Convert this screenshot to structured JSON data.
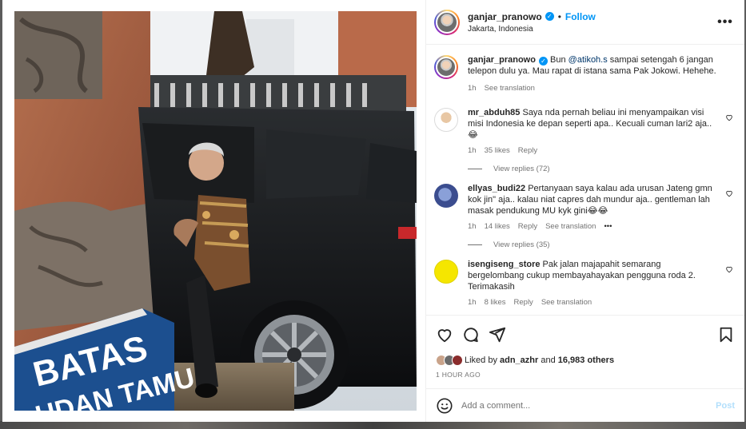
{
  "post": {
    "username": "ganjar_pranowo",
    "follow_label": "Follow",
    "location": "Jakarta, Indonesia",
    "more_label": "•••"
  },
  "photo": {
    "sign_line1": "BATAS",
    "sign_line2": "UDAN TAMU"
  },
  "caption": {
    "username": "ganjar_pranowo",
    "text_before": " Bun ",
    "mention": "@atikoh.s",
    "text_after": " sampai setengah 6 jangan telepon dulu ya. Mau rapat di istana sama Pak Jokowi. Hehehe.",
    "time": "1h",
    "translate": "See translation"
  },
  "comments": [
    {
      "username": "mr_abduh85",
      "text": " Saya nda pernah beliau ini menyampaikan visi misi Indonesia ke depan seperti apa.. Kecuali cuman lari2 aja.. 😂",
      "time": "1h",
      "likes": "35 likes",
      "reply": "Reply",
      "translate": "",
      "view_replies": "View replies (72)"
    },
    {
      "username": "ellyas_budi22",
      "text": " Pertanyaan saya kalau ada urusan Jateng gmn kok jin\" aja.. kalau niat capres dah mundur aja.. gentleman lah masak pendukung MU kyk gini😂😂",
      "time": "1h",
      "likes": "14 likes",
      "reply": "Reply",
      "translate": "See translation",
      "options": "•••",
      "view_replies": "View replies (35)"
    },
    {
      "username": "isengiseng_store",
      "text": " Pak jalan majapahit semarang bergelombang cukup membayahayakan pengguna roda 2. Terimakasih",
      "time": "1h",
      "likes": "8 likes",
      "reply": "Reply",
      "translate": "See translation"
    }
  ],
  "likes": {
    "prefix": "Liked by ",
    "user": "adn_azhr",
    "middle": " and ",
    "count": "16,983 others"
  },
  "timestamp": "1 HOUR AGO",
  "composer": {
    "placeholder": "Add a comment...",
    "post_label": "Post"
  },
  "colors": {
    "accent": "#0095f6",
    "mention": "#00376b",
    "muted": "#737373",
    "sign_blue": "#1c4f8f"
  },
  "icons": [
    "like-icon",
    "comment-icon",
    "share-icon",
    "save-icon",
    "emoji-icon",
    "verified-icon",
    "more-icon"
  ]
}
